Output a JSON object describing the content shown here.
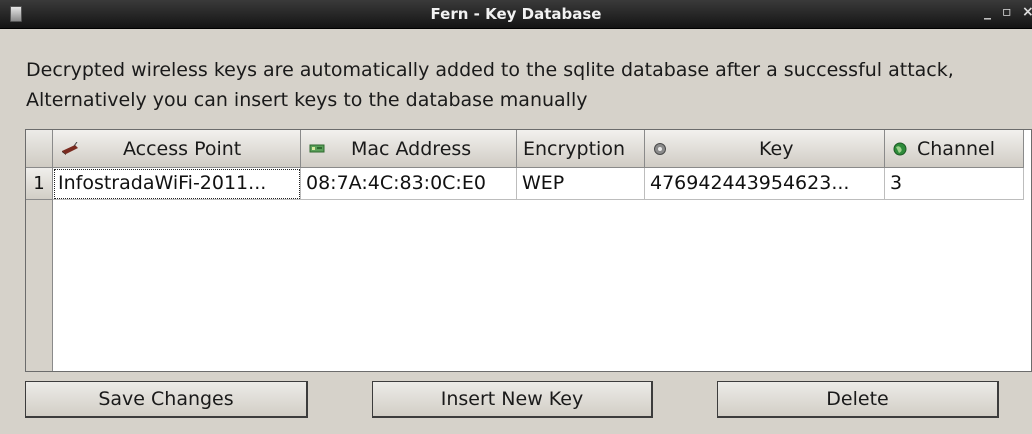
{
  "window": {
    "title": "Fern - Key Database",
    "minimize": "_",
    "maximize": "▫",
    "close": "×"
  },
  "description": "Decrypted wireless keys are automatically added to the sqlite database after a successful attack, Alternatively you can insert keys to the database manually",
  "table": {
    "columns": [
      {
        "label": "Access Point",
        "icon": "access-point-icon"
      },
      {
        "label": "Mac Address",
        "icon": "network-card-icon"
      },
      {
        "label": "Encryption",
        "icon": ""
      },
      {
        "label": "Key",
        "icon": "key-icon"
      },
      {
        "label": "Channel",
        "icon": "globe-icon"
      }
    ],
    "rows": [
      {
        "index": "1",
        "cells": [
          "InfostradaWiFi-2011...",
          "08:7A:4C:83:0C:E0",
          "WEP",
          "476942443954623...",
          "3"
        ]
      }
    ]
  },
  "buttons": {
    "save": "Save Changes",
    "insert": "Insert New Key",
    "delete": "Delete"
  }
}
